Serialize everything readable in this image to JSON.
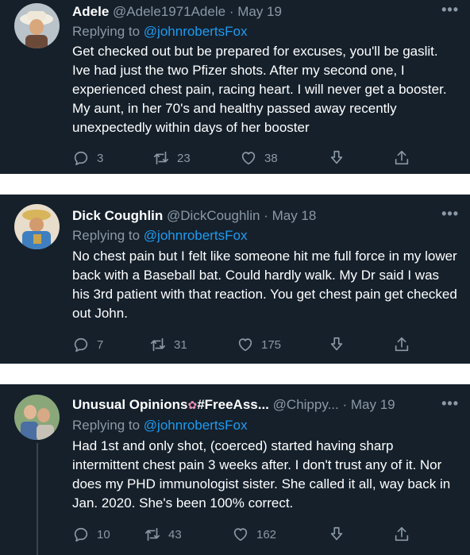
{
  "tweets": [
    {
      "name": "Adele",
      "handle": "@Adele1971Adele",
      "dot": "·",
      "date": "May 19",
      "more": "•••",
      "replying_label": "Replying to",
      "replying_to": "@johnrobertsFox",
      "text": "Get checked out but be prepared for excuses, you'll be gaslit. Ive had just the two Pfizer shots. After my second one, I experienced chest pain, racing heart. I will never get a booster. My aunt, in her 70's and healthy passed away recently unexpectedly within days of her booster",
      "reply_count": "3",
      "retweet_count": "23",
      "like_count": "38"
    },
    {
      "name": "Dick Coughlin",
      "handle": "@DickCoughlin",
      "dot": "·",
      "date": "May 18",
      "more": "•••",
      "replying_label": "Replying to",
      "replying_to": "@johnrobertsFox",
      "text": "No chest pain but I felt like someone hit me full force in my lower back with a Baseball bat. Could hardly walk. My Dr said I was his 3rd patient with that reaction. You get chest pain get checked out John.",
      "reply_count": "7",
      "retweet_count": "31",
      "like_count": "175"
    },
    {
      "name": "Unusual Opinions",
      "name_suffix": "#FreeAss...",
      "name_emoji": "✿",
      "handle": "@Chippy...",
      "dot": "·",
      "date": "May 19",
      "more": "•••",
      "replying_label": "Replying to",
      "replying_to": "@johnrobertsFox",
      "text": "Had 1st and only shot, (coerced) started having sharp intermittent chest pain 3 weeks after. I don't trust any of it. Nor does my PHD immunologist sister. She called it all, way back in Jan. 2020. She's been 100% correct.",
      "reply_count": "10",
      "retweet_count": "43",
      "like_count": "162"
    }
  ],
  "icons": [
    "reply-icon",
    "retweet-icon",
    "like-icon",
    "download-icon",
    "share-icon"
  ],
  "colors": {
    "background": "#15202b",
    "name": "#ffffff",
    "secondary": "#8b98a5",
    "mention": "#1d9bf0",
    "divider": "#ffffff"
  }
}
